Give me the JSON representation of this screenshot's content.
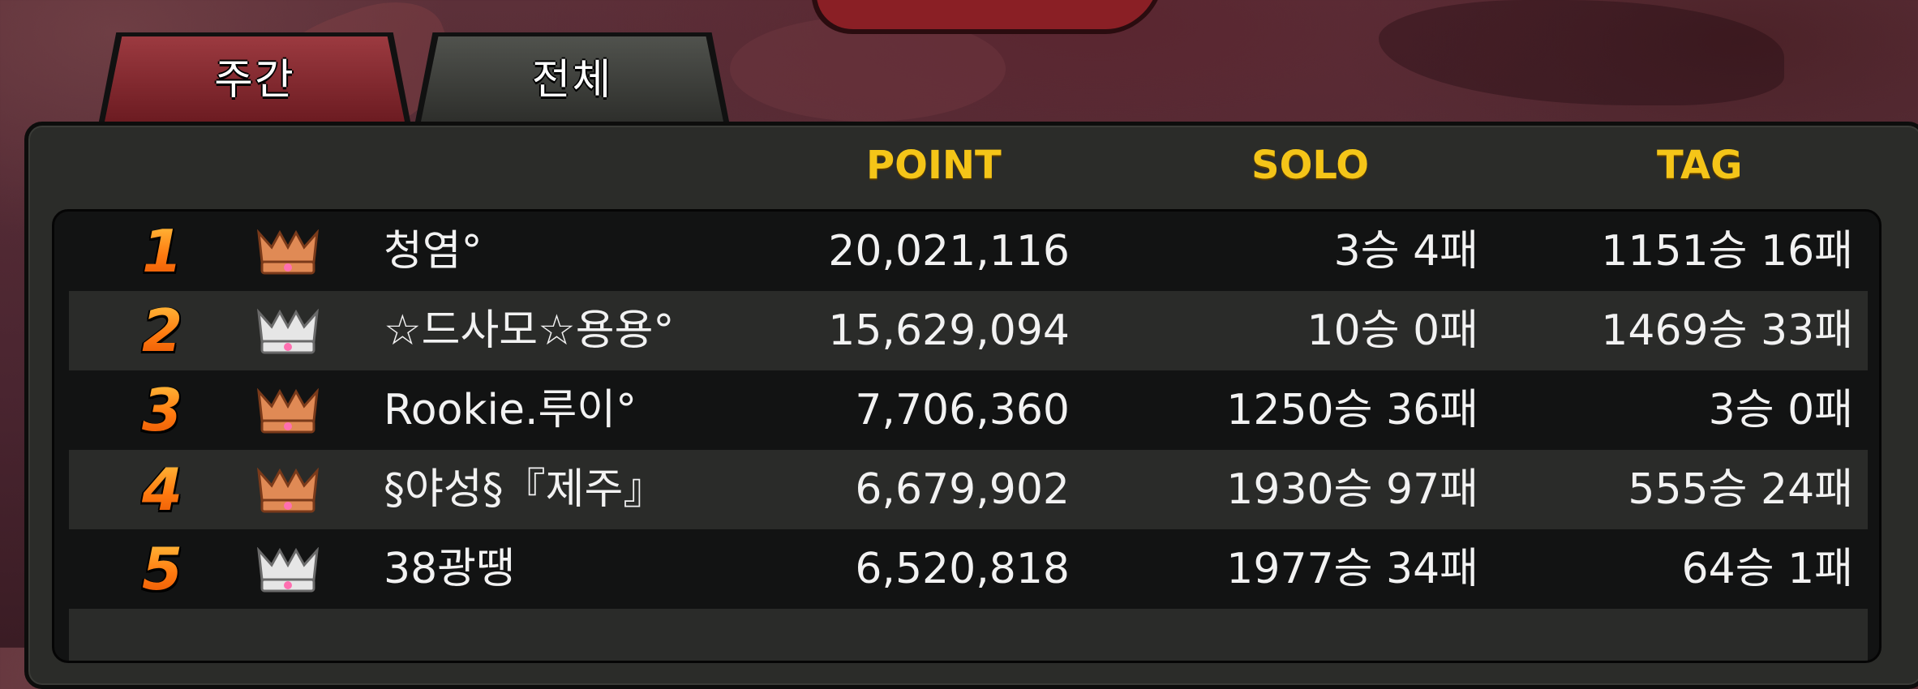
{
  "tabs": [
    {
      "label": "주간",
      "active": false
    },
    {
      "label": "전체",
      "active": true
    }
  ],
  "columns": {
    "point": "POINT",
    "solo": "SOLO",
    "tag": "TAG"
  },
  "rows": [
    {
      "rank": "1",
      "crown": "gold",
      "name": "청염°",
      "point": "20,021,116",
      "solo": "3승 4패",
      "tag": "1151승 16패"
    },
    {
      "rank": "2",
      "crown": "silver",
      "name": "☆드사모☆용용°",
      "point": "15,629,094",
      "solo": "10승 0패",
      "tag": "1469승 33패"
    },
    {
      "rank": "3",
      "crown": "gold",
      "name": "Rookie.루이°",
      "point": "7,706,360",
      "solo": "1250승 36패",
      "tag": "3승 0패"
    },
    {
      "rank": "4",
      "crown": "gold",
      "name": "§야성§『제주』",
      "point": "6,679,902",
      "solo": "1930승 97패",
      "tag": "555승 24패"
    },
    {
      "rank": "5",
      "crown": "silver",
      "name": "38광땡",
      "point": "6,520,818",
      "solo": "1977승 34패",
      "tag": "64승 1패"
    }
  ],
  "colors": {
    "header_text": "#f5c518",
    "rank_orange": "#ff7a10",
    "crown_gold": "#e08a55",
    "crown_silver": "#e6e6e6",
    "tab_weekly": "#8a2a30",
    "tab_all": "#3e3f3b"
  }
}
